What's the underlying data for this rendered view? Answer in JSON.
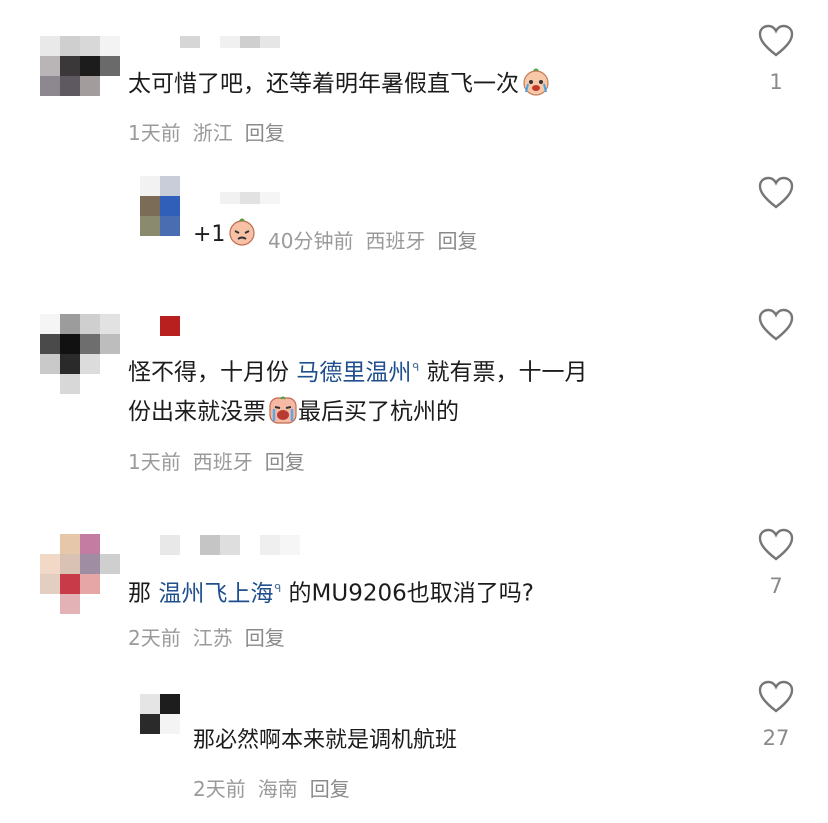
{
  "comments": [
    {
      "text": "太可惜了吧，还等着明年暑假直飞一次",
      "emoji": "crying-face-emoji",
      "time": "1天前",
      "location": "浙江",
      "reply": "回复",
      "likes": "1"
    },
    {
      "text": "+1",
      "emoji": "pouting-face-emoji",
      "time": "40分钟前",
      "location": "西班牙",
      "reply": "回复",
      "likes": ""
    },
    {
      "line1_pre": "怪不得，十月份 ",
      "line1_link": "马德里温州",
      "line1_post": " 就有票，十一月",
      "line2_pre": "份出来就没票",
      "line2_post": "最后买了杭州的",
      "emoji": "crying-loudly-emoji",
      "time": "1天前",
      "location": "西班牙",
      "reply": "回复",
      "likes": ""
    },
    {
      "pre": "那 ",
      "link": "温州飞上海",
      "post": " 的MU9206也取消了吗?",
      "time": "2天前",
      "location": "江苏",
      "reply": "回复",
      "likes": "7"
    },
    {
      "text": "那必然啊本来就是调机航班",
      "time": "2天前",
      "location": "海南",
      "reply": "回复",
      "likes": "27"
    }
  ],
  "search_glyph": "ᑫ",
  "colors": {
    "link": "#1f4f8f",
    "meta": "#9a9a9a",
    "text": "#1c1c1c"
  }
}
